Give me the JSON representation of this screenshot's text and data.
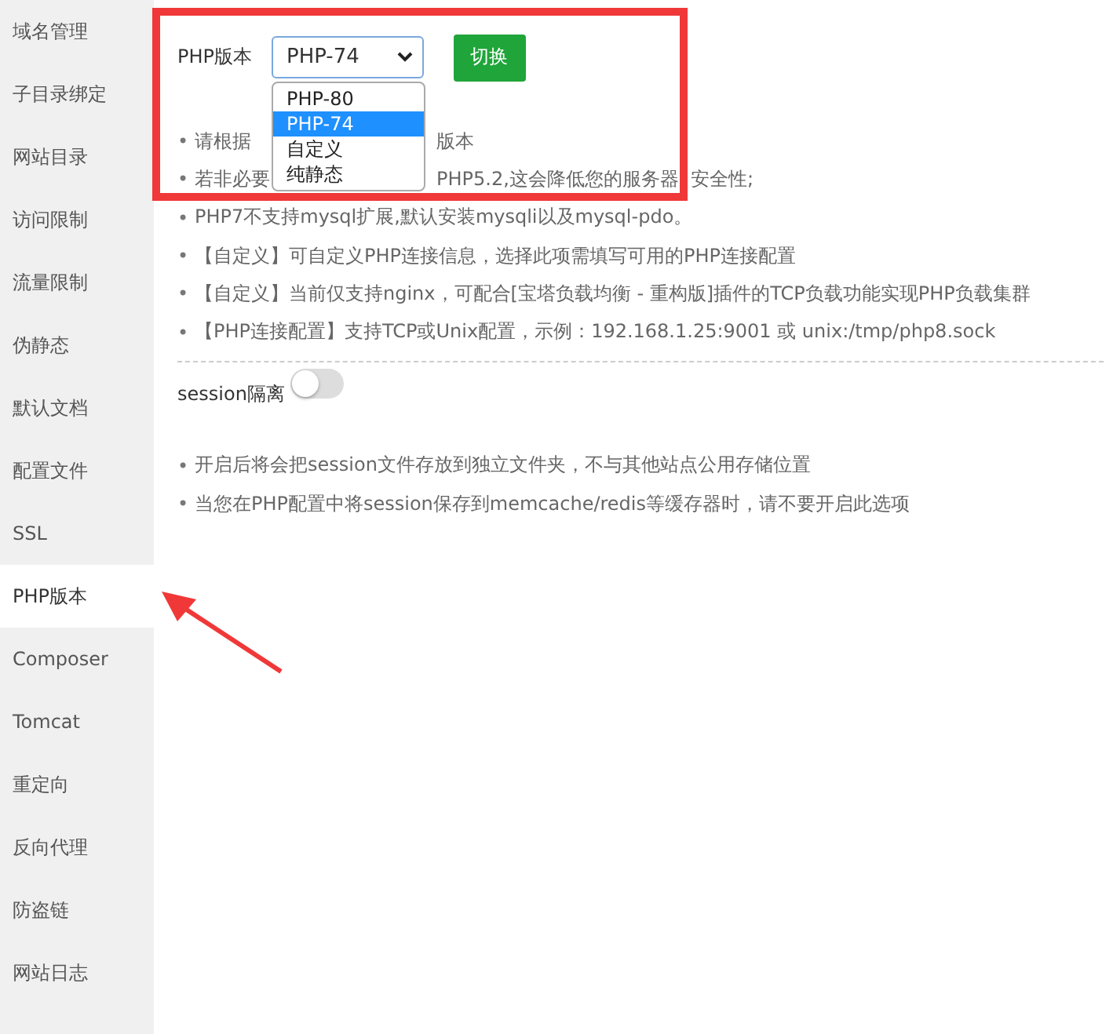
{
  "sidebar": {
    "items": [
      {
        "label": "域名管理",
        "selected": false
      },
      {
        "label": "子目录绑定",
        "selected": false
      },
      {
        "label": "网站目录",
        "selected": false
      },
      {
        "label": "访问限制",
        "selected": false
      },
      {
        "label": "流量限制",
        "selected": false
      },
      {
        "label": "伪静态",
        "selected": false
      },
      {
        "label": "默认文档",
        "selected": false
      },
      {
        "label": "配置文件",
        "selected": false
      },
      {
        "label": "SSL",
        "selected": false
      },
      {
        "label": "PHP版本",
        "selected": true
      },
      {
        "label": "Composer",
        "selected": false
      },
      {
        "label": "Tomcat",
        "selected": false
      },
      {
        "label": "重定向",
        "selected": false
      },
      {
        "label": "反向代理",
        "selected": false
      },
      {
        "label": "防盗链",
        "selected": false
      },
      {
        "label": "网站日志",
        "selected": false
      }
    ]
  },
  "php_version": {
    "label": "PHP版本",
    "value": "PHP-74",
    "button": "切换",
    "dropdown": {
      "options": [
        {
          "label": "PHP-80",
          "selected": false
        },
        {
          "label": "PHP-74",
          "selected": true
        },
        {
          "label": "自定义",
          "selected": false
        },
        {
          "label": "纯静态",
          "selected": false
        }
      ]
    }
  },
  "notes": [
    {
      "bullet": "•",
      "parts": [
        "请根据",
        "版本"
      ]
    },
    {
      "bullet": "•",
      "parts": [
        "若非必要",
        "PHP5.2,这会降低您的服务器",
        "安全性;"
      ]
    },
    {
      "bullet": "•",
      "parts": [
        "PHP7不支持mysql扩展,默认安装mysqli以及mysql-pdo。"
      ]
    },
    {
      "bullet": "•",
      "parts": [
        "【自定义】可自定义PHP连接信息，选择此项需填写可用的PHP连接配置"
      ]
    },
    {
      "bullet": "•",
      "parts": [
        "【自定义】当前仅支持nginx，可配合[宝塔负载均衡 - 重构版]插件的TCP负载功能实现PHP负载集群"
      ]
    },
    {
      "bullet": "•",
      "parts": [
        "【PHP连接配置】支持TCP或Unix配置，示例：192.168.1.25:9001 或 unix:/tmp/php8.sock"
      ]
    }
  ],
  "session": {
    "label": "session隔离",
    "on": false,
    "notes": [
      {
        "bullet": "•",
        "parts": [
          "开启后将会把session文件存放到独立文件夹，不与其他站点公用存储位置"
        ]
      },
      {
        "bullet": "•",
        "parts": [
          "当您在PHP配置中将session保存到memcache/redis等缓存器时，请不要开启此选项"
        ]
      }
    ]
  }
}
